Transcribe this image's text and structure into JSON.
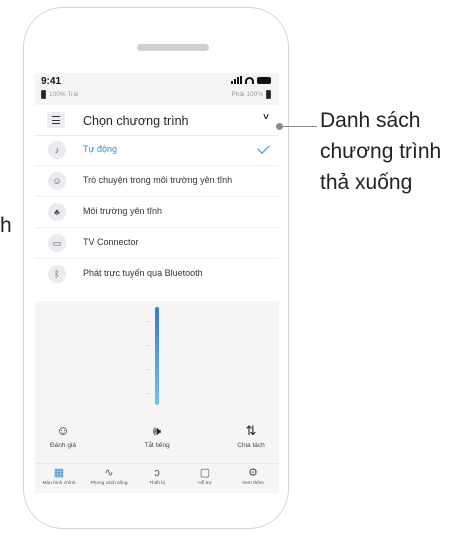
{
  "left_fragment": "h",
  "callout": "Danh sách chương trình thả xuống",
  "status": {
    "time": "9:41",
    "left_ear": "100%  Trái",
    "right_ear": "Phải  100%"
  },
  "dropdown": {
    "title": "Chọn chương trình",
    "chevron": "˅",
    "items": [
      {
        "label": "Tự động",
        "icon": "auto-icon",
        "selected": true
      },
      {
        "label": "Trò chuyện trong môi trường yên tĩnh",
        "icon": "conversation-icon",
        "selected": false
      },
      {
        "label": "Môi trường yên tĩnh",
        "icon": "quiet-icon",
        "selected": false
      },
      {
        "label": "TV Connector",
        "icon": "tv-icon",
        "selected": false
      },
      {
        "label": "Phát trực tuyến qua Bluetooth",
        "icon": "bluetooth-icon",
        "selected": false
      }
    ]
  },
  "volume_level": 0.9,
  "actions": {
    "rate": {
      "label": "Đánh giá",
      "icon": "smiley-icon"
    },
    "mute": {
      "label": "Tắt tiếng",
      "icon": "speaker-icon"
    },
    "split": {
      "label": "Chia tách",
      "icon": "split-icon"
    }
  },
  "nav": [
    {
      "label": "Màn hình chính",
      "icon": "home-grid-icon",
      "active": true
    },
    {
      "label": "Phong cách sống",
      "icon": "activity-icon",
      "active": false
    },
    {
      "label": "Thiết bị",
      "icon": "hearing-aid-icon",
      "active": false
    },
    {
      "label": "Hỗ trợ",
      "icon": "chat-icon",
      "active": false
    },
    {
      "label": "Xem thêm",
      "icon": "gear-icon",
      "active": false
    }
  ],
  "colors": {
    "accent": "#2e8fd6",
    "slider_top": "#3b7bc8",
    "slider_bottom": "#77c0ef"
  }
}
